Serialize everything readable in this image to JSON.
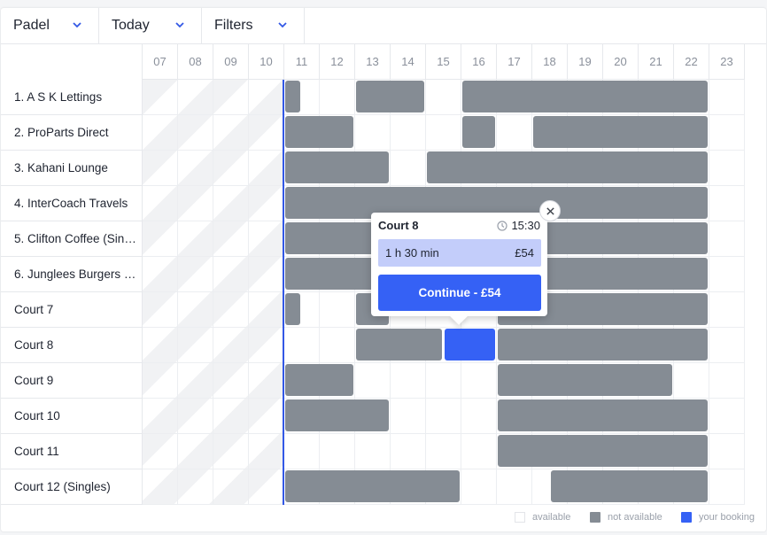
{
  "filters": {
    "sport": "Padel",
    "date": "Today",
    "filters_label": "Filters"
  },
  "hours": [
    "07",
    "08",
    "09",
    "10",
    "11",
    "12",
    "13",
    "14",
    "15",
    "16",
    "17",
    "18",
    "19",
    "20",
    "21",
    "22",
    "23"
  ],
  "courts": [
    {
      "name": "1. A S K Lettings",
      "unavailable": [
        [
          11,
          11.5
        ],
        [
          13,
          15
        ],
        [
          16,
          23
        ]
      ],
      "booking": null
    },
    {
      "name": "2. ProParts Direct",
      "unavailable": [
        [
          11,
          13
        ],
        [
          16,
          17
        ],
        [
          18,
          23
        ]
      ],
      "booking": null
    },
    {
      "name": "3. Kahani Lounge",
      "unavailable": [
        [
          11,
          14
        ],
        [
          15,
          23
        ]
      ],
      "booking": null
    },
    {
      "name": "4. InterCoach Travels",
      "unavailable": [
        [
          11,
          23
        ]
      ],
      "booking": null
    },
    {
      "name": "5. Clifton Coffee (Singles)",
      "unavailable": [
        [
          11,
          23
        ]
      ],
      "booking": null
    },
    {
      "name": "6. Junglees Burgers (Singles)",
      "unavailable": [
        [
          11,
          23
        ]
      ],
      "booking": null
    },
    {
      "name": "Court 7",
      "unavailable": [
        [
          11,
          11.5
        ],
        [
          13,
          14
        ],
        [
          17,
          23
        ]
      ],
      "booking": null
    },
    {
      "name": "Court 8",
      "unavailable": [
        [
          13,
          15.5
        ],
        [
          17,
          23
        ]
      ],
      "booking": [
        15.5,
        17
      ]
    },
    {
      "name": "Court 9",
      "unavailable": [
        [
          11,
          13
        ],
        [
          17,
          22
        ]
      ],
      "booking": null
    },
    {
      "name": "Court 10",
      "unavailable": [
        [
          11,
          14
        ],
        [
          17,
          23
        ]
      ],
      "booking": null
    },
    {
      "name": "Court 11",
      "unavailable": [
        [
          17,
          23
        ]
      ],
      "booking": null
    },
    {
      "name": "Court 12 (Singles)",
      "unavailable": [
        [
          11,
          16
        ],
        [
          18.5,
          23
        ]
      ],
      "booking": null
    }
  ],
  "popup": {
    "court": "Court 8",
    "time": "15:30",
    "duration": "1 h 30 min",
    "price": "£54",
    "button": "Continue - £54"
  },
  "legend": {
    "available": "available",
    "not_available": "not available",
    "your_booking": "your booking"
  },
  "colors": {
    "unavailable": "#858c94",
    "booking": "#3561f5",
    "accent": "#3358e6"
  }
}
